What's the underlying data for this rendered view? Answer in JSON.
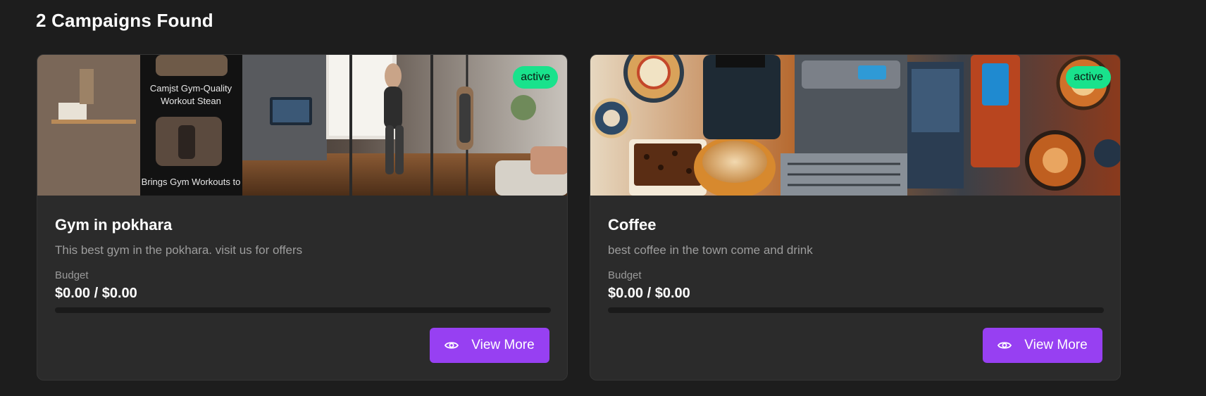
{
  "heading": "2 Campaigns Found",
  "campaigns": [
    {
      "image_icon": "gym-image",
      "status": "active",
      "title": "Gym in pokhara",
      "description": "This best gym in the pokhara. visit us for offers",
      "budget_label": "Budget",
      "budget_value": "$0.00 / $0.00",
      "budget_progress": 0,
      "button_icon": "eye-icon",
      "button_label": "View More"
    },
    {
      "image_icon": "coffee-image",
      "status": "active",
      "title": "Coffee",
      "description": "best coffee in the town come and drink",
      "budget_label": "Budget",
      "budget_value": "$0.00 / $0.00",
      "budget_progress": 0,
      "button_icon": "eye-icon",
      "button_label": "View More"
    }
  ],
  "colors": {
    "background": "#1d1d1d",
    "card": "#2b2b2b",
    "badge": "#19e28c",
    "accent": "#9740f2"
  }
}
